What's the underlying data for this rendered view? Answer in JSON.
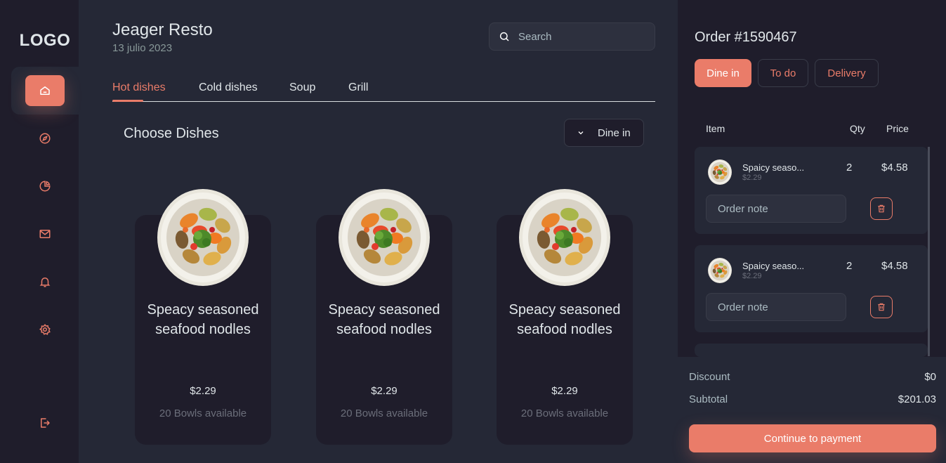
{
  "sidebar": {
    "logo": "LOGO",
    "icons": [
      "home-icon",
      "compass-icon",
      "pie-chart-icon",
      "mail-icon",
      "bell-icon",
      "settings-icon",
      "logout-icon"
    ],
    "accent": "#ea7c69"
  },
  "header": {
    "title": "Jeager Resto",
    "date": "13 julio 2023",
    "search_placeholder": "Search"
  },
  "tabs": [
    {
      "label": "Hot dishes",
      "active": true
    },
    {
      "label": "Cold dishes",
      "active": false
    },
    {
      "label": "Soup",
      "active": false
    },
    {
      "label": "Grill",
      "active": false
    }
  ],
  "main": {
    "section_title": "Choose Dishes",
    "dine_select": "Dine in"
  },
  "dishes": [
    {
      "name": "Speacy seasoned seafood nodles",
      "price": "$2.29",
      "availability": "20 Bowls available"
    },
    {
      "name": "Speacy seasoned seafood nodles",
      "price": "$2.29",
      "availability": "20 Bowls available"
    },
    {
      "name": "Speacy seasoned seafood nodles",
      "price": "$2.29",
      "availability": "20 Bowls available"
    }
  ],
  "order": {
    "title": "Order #1590467",
    "modes": [
      {
        "label": "Dine in",
        "active": true
      },
      {
        "label": "To do",
        "active": false
      },
      {
        "label": "Delivery",
        "active": false
      }
    ],
    "columns": {
      "item": "Item",
      "qty": "Qty",
      "price": "Price"
    },
    "items": [
      {
        "name": "Spaicy seaso...",
        "unit_price": "$2.29",
        "qty": "2",
        "total": "$4.58",
        "note_placeholder": "Order note"
      },
      {
        "name": "Spaicy seaso...",
        "unit_price": "$2.29",
        "qty": "2",
        "total": "$4.58",
        "note_placeholder": "Order note"
      }
    ],
    "discount_label": "Discount",
    "discount_value": "$0",
    "subtotal_label": "Subtotal",
    "subtotal_value": "$201.03",
    "pay_button": "Continue to payment"
  }
}
